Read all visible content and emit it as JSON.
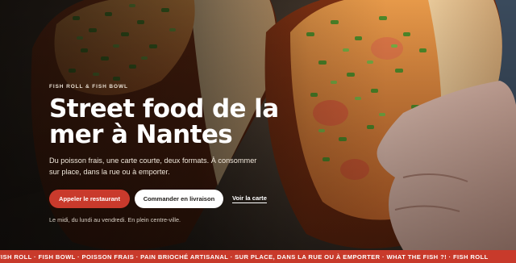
{
  "hero": {
    "eyebrow": "FISH ROLL & FISH BOWL",
    "title": "Street food de la mer à Nantes",
    "subtitle": "Du poisson frais, une carte courte, deux formats. À consommer sur place, dans la rue ou à emporter.",
    "note": "Le midi, du lundi au vendredi. En plein centre-ville.",
    "image": "photo of two brioche lobster rolls topped with chives"
  },
  "actions": {
    "call_label": "Appeler le restaurant",
    "order_label": "Commander en livraison",
    "menu_link_label": "Voir la carte"
  },
  "ticker": {
    "text": "FISH ROLL · FISH BOWL · POISSON FRAIS · PAIN BRIOCHÉ ARTISANAL · SUR PLACE, DANS LA RUE OU À EMPORTER · WHAT THE FISH ?! · FISH ROLL"
  },
  "colors": {
    "accent": "#c93a2c",
    "ticker_bg": "#c83a2b",
    "button_secondary_bg": "#ffffff"
  }
}
